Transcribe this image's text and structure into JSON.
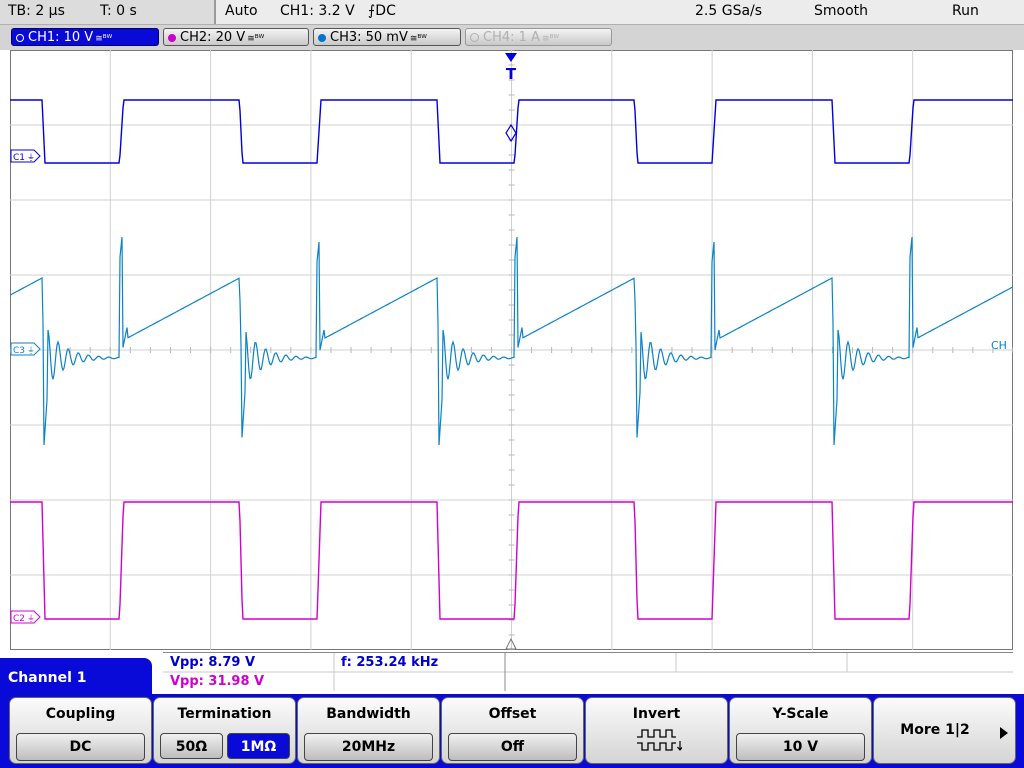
{
  "status": {
    "timebase": "TB: 2 µs",
    "trigger_time": "T: 0 s",
    "trigger_mode": "Auto",
    "trigger_info": "CH1: 3.2 V",
    "trigger_slope": "⨍DC",
    "sample_rate": "2.5 GSa/s",
    "acq_mode": "Smooth",
    "run_state": "Run"
  },
  "channels": [
    {
      "label": "CH1: 10 V",
      "coupling": "≅ᴮᵂ",
      "color": "#0000dd"
    },
    {
      "label": "CH2: 20 V",
      "coupling": "≅ᴮᵂ",
      "color": "#cc00cc"
    },
    {
      "label": "CH3: 50 mV",
      "coupling": "≅ᴮᵂ",
      "color": "#0077cc"
    },
    {
      "label": "CH4: 1 A",
      "coupling": "≅ᴮᵂ",
      "color": "#b0b0b0"
    }
  ],
  "markers": {
    "c1": "C1",
    "c2": "C2",
    "c3": "C3",
    "trigger": "T",
    "ch_right": "CH"
  },
  "measurements": {
    "vpp1": "Vpp: 8.79 V",
    "freq1": "f: 253.24 kHz",
    "vpp2": "Vpp: 31.98 V"
  },
  "panel": {
    "channel_title": "Channel 1"
  },
  "softkeys": {
    "coupling": {
      "title": "Coupling",
      "value": "DC"
    },
    "termination": {
      "title": "Termination",
      "opt1": "50Ω",
      "opt2": "1MΩ"
    },
    "bandwidth": {
      "title": "Bandwidth",
      "value": "20MHz"
    },
    "offset": {
      "title": "Offset",
      "value": "Off"
    },
    "invert": {
      "title": "Invert"
    },
    "yscale": {
      "title": "Y-Scale",
      "value": "10 V"
    },
    "more": {
      "title": "More 1|2"
    }
  }
}
